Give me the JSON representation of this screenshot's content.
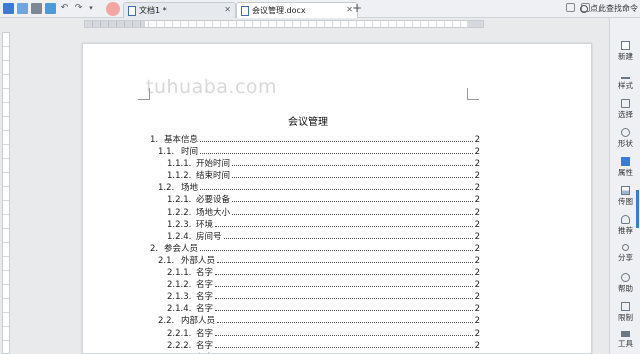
{
  "tabs": [
    {
      "label": "文档1 *"
    },
    {
      "label": "会议管理.docx"
    }
  ],
  "search_command": "点此查找命令",
  "watermark": "tuhuaba.com",
  "doc_title": "会议管理",
  "toc": [
    {
      "num": "1.",
      "label": "基本信息",
      "page": "2",
      "level": 1
    },
    {
      "num": "1.1.",
      "label": "时间",
      "page": "2",
      "level": 2
    },
    {
      "num": "1.1.1.",
      "label": "开始时间",
      "page": "2",
      "level": 3
    },
    {
      "num": "1.1.2.",
      "label": "结束时间",
      "page": "2",
      "level": 3
    },
    {
      "num": "1.2.",
      "label": "场地",
      "page": "2",
      "level": 2
    },
    {
      "num": "1.2.1.",
      "label": "必要设备",
      "page": "2",
      "level": 3
    },
    {
      "num": "1.2.2.",
      "label": "场地大小",
      "page": "2",
      "level": 3
    },
    {
      "num": "1.2.3.",
      "label": "环境",
      "page": "2",
      "level": 3
    },
    {
      "num": "1.2.4.",
      "label": "房间号",
      "page": "2",
      "level": 3
    },
    {
      "num": "2.",
      "label": "参会人员",
      "page": "2",
      "level": 1
    },
    {
      "num": "2.1.",
      "label": "外部人员",
      "page": "2",
      "level": 2
    },
    {
      "num": "2.1.1.",
      "label": "名字",
      "page": "2",
      "level": 3
    },
    {
      "num": "2.1.2.",
      "label": "名字",
      "page": "2",
      "level": 3
    },
    {
      "num": "2.1.3.",
      "label": "名字",
      "page": "2",
      "level": 3
    },
    {
      "num": "2.1.4.",
      "label": "名字",
      "page": "2",
      "level": 3
    },
    {
      "num": "2.2.",
      "label": "内部人员",
      "page": "2",
      "level": 2
    },
    {
      "num": "2.2.1.",
      "label": "名字",
      "page": "2",
      "level": 3
    },
    {
      "num": "2.2.2.",
      "label": "名字",
      "page": "2",
      "level": 3
    },
    {
      "num": "2.2.3.",
      "label": "名字",
      "page": "2",
      "level": 3
    }
  ],
  "sidebar": [
    {
      "label": "新建",
      "icon": "new-doc-icon"
    },
    {
      "label": "样式",
      "icon": "style-icon"
    },
    {
      "label": "选择",
      "icon": "select-icon"
    },
    {
      "label": "形状",
      "icon": "shape-icon"
    },
    {
      "label": "属性",
      "icon": "properties-icon"
    },
    {
      "label": "传图",
      "icon": "upload-image-icon"
    },
    {
      "label": "推荐",
      "icon": "recommend-icon"
    },
    {
      "label": "分享",
      "icon": "share-icon"
    },
    {
      "label": "帮助",
      "icon": "help-icon"
    },
    {
      "label": "限制",
      "icon": "restrict-icon"
    },
    {
      "label": "工具",
      "icon": "tools-icon"
    }
  ],
  "colors": {
    "accent": "#3b7bd5",
    "page": "#ffffff",
    "background": "#e9eaec"
  }
}
